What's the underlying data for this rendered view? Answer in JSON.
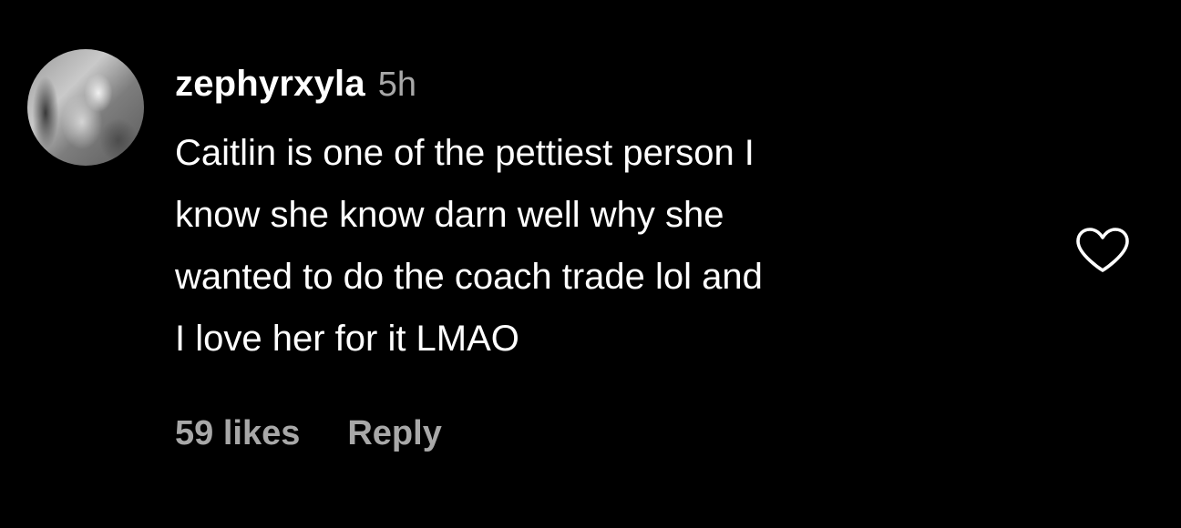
{
  "comment": {
    "username": "zephyrxyla",
    "timestamp": "5h",
    "text_lines": [
      "Caitlin is one of the pettiest person I",
      "know she know darn well why she",
      "wanted to do the coach trade lol and",
      "I love her for it LMAO"
    ],
    "likes": "59 likes",
    "reply_label": "Reply",
    "like_icon": "heart-outline-icon"
  },
  "colors": {
    "background": "#000000",
    "primary_text": "#ffffff",
    "secondary_text": "#a8a8a8"
  }
}
